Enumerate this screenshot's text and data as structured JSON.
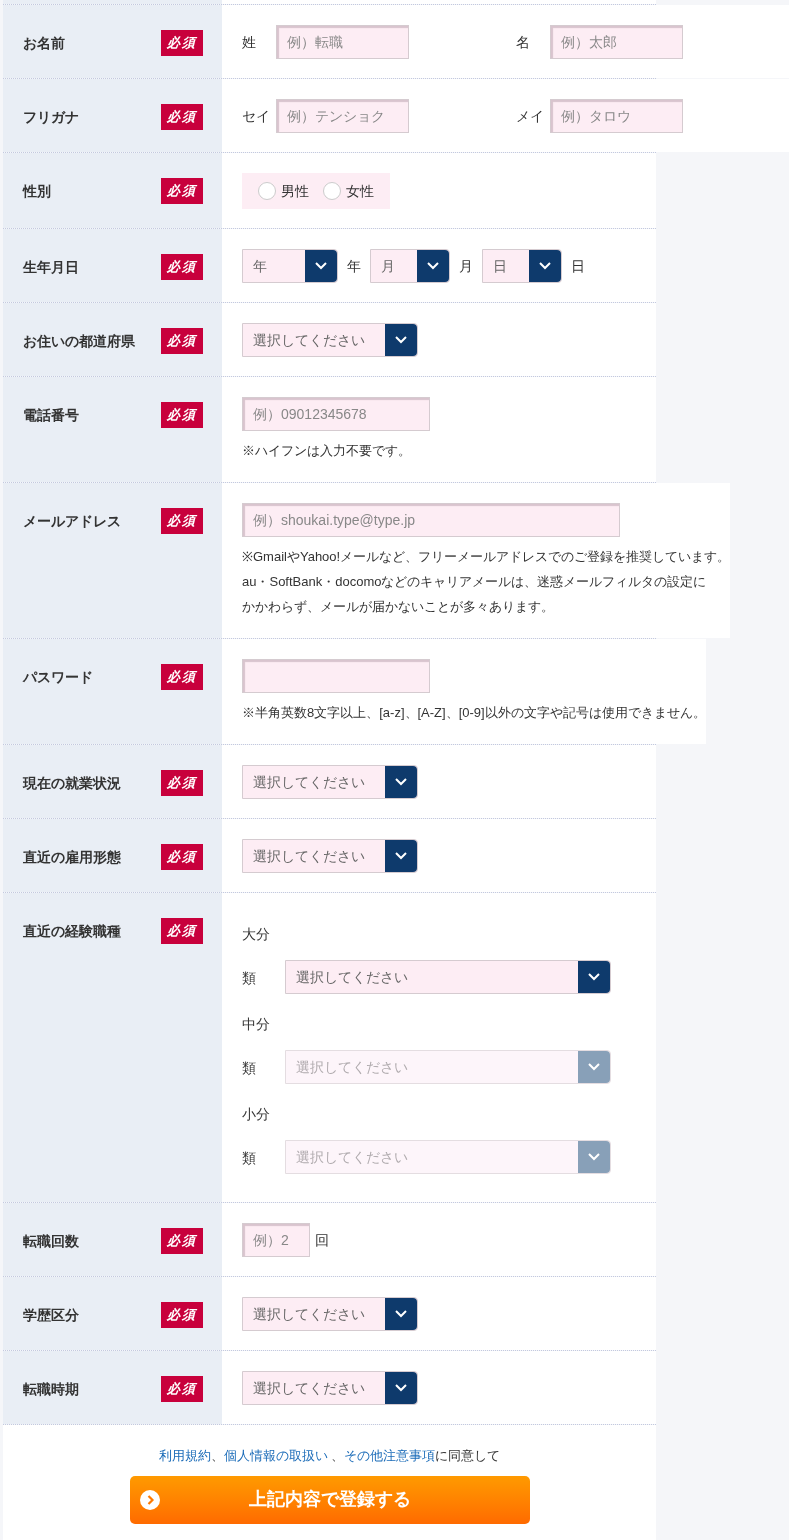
{
  "rows": [
    {
      "kind": "pair",
      "label": "お名前",
      "badge": "必須",
      "fields": [
        {
          "label": "姓",
          "placeholder": "例）転職"
        },
        {
          "label": "名",
          "placeholder": "例）太郎"
        }
      ]
    },
    {
      "kind": "pair",
      "label": "フリガナ",
      "badge": "必須",
      "fields": [
        {
          "label": "セイ",
          "placeholder": "例）テンショク"
        },
        {
          "label": "メイ",
          "placeholder": "例）タロウ"
        }
      ]
    },
    {
      "kind": "radio",
      "label": "性別",
      "badge": "必須",
      "options": [
        {
          "label": "男性",
          "selected": false
        },
        {
          "label": "女性",
          "selected": false
        }
      ]
    },
    {
      "kind": "date",
      "label": "生年月日",
      "badge": "必須",
      "parts": [
        {
          "value": "年",
          "unit": "年"
        },
        {
          "value": "月",
          "unit": "月"
        },
        {
          "value": "日",
          "unit": "日"
        }
      ]
    },
    {
      "kind": "select",
      "label": "お住いの都道府県",
      "badge": "必須",
      "value": "選択してください"
    },
    {
      "kind": "text",
      "label": "電話番号",
      "badge": "必須",
      "placeholder": "例）09012345678",
      "note": [
        "※ハイフンは入力不要です。"
      ]
    },
    {
      "kind": "text",
      "label": "メールアドレス",
      "badge": "必須",
      "placeholder": "例）shoukai.type@type.jp",
      "note": [
        "※GmailやYahoo!メールなど、フリーメールアドレスでのご登録を推奨しています。",
        "au・SoftBank・docomoなどのキャリアメールは、迷惑メールフィルタの設定に",
        "かかわらず、メールが届かないことが多々あります。"
      ]
    },
    {
      "kind": "text",
      "label": "パスワード",
      "badge": "必須",
      "note": [
        "※半角英数8文字以上、[a-z]、[A-Z]、[0-9]以外の文字や記号は使用できません。"
      ]
    },
    {
      "kind": "select",
      "label": "現在の就業状況",
      "badge": "必須",
      "value": "選択してください"
    },
    {
      "kind": "select",
      "label": "直近の雇用形態",
      "badge": "必須",
      "value": "選択してください"
    },
    {
      "kind": "cascade",
      "label": "直近の経験職種",
      "badge": "必須",
      "levels": [
        {
          "label": "大分類",
          "value": "選択してください",
          "disabled": false
        },
        {
          "label": "中分類",
          "value": "選択してください",
          "disabled": true
        },
        {
          "label": "小分類",
          "value": "選択してください",
          "disabled": true
        }
      ]
    },
    {
      "kind": "count",
      "label": "転職回数",
      "badge": "必須",
      "placeholder": "例）2",
      "unit": "回"
    },
    {
      "kind": "select",
      "label": "学歴区分",
      "badge": "必須",
      "value": "選択してください"
    },
    {
      "kind": "select",
      "label": "転職時期",
      "badge": "必須",
      "value": "選択してください"
    }
  ],
  "consent": [
    {
      "text": "利用規約",
      "link": true
    },
    {
      "text": "、",
      "link": false
    },
    {
      "text": "個人情報の取扱い",
      "link": true
    },
    {
      "text": " 、",
      "link": false
    },
    {
      "text": "その他注意事項",
      "link": true
    },
    {
      "text": "に同意して",
      "link": false
    }
  ],
  "submit": "上記内容で登録する"
}
